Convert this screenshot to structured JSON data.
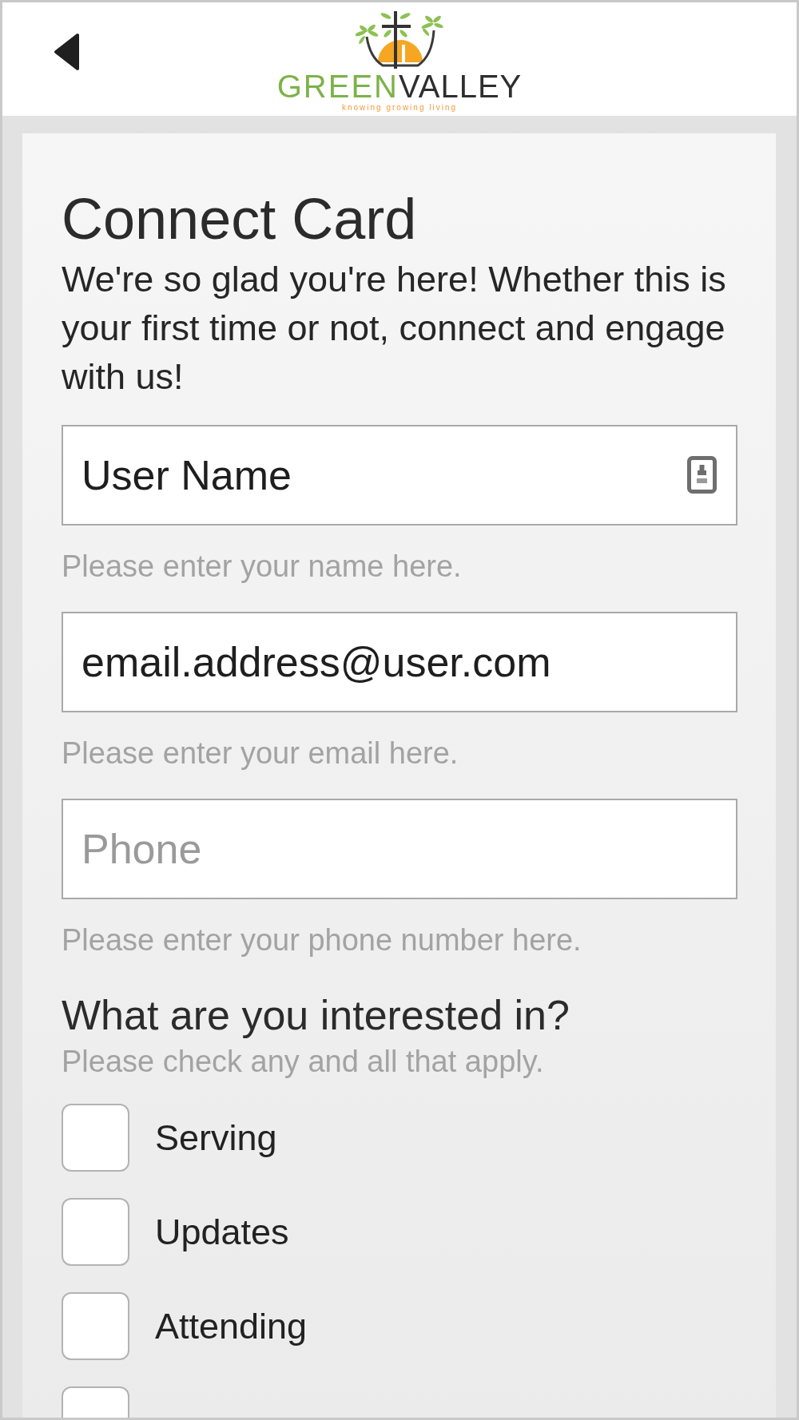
{
  "header": {
    "logo": {
      "wordmark": [
        "GREEN",
        "VALLEY"
      ],
      "tagline": "knowing growing living"
    }
  },
  "form": {
    "title": "Connect Card",
    "intro": "We're so glad you're here! Whether this is your first time or not, connect and engage with us!",
    "fields": [
      {
        "kind": "autofill",
        "value": "User Name",
        "help": "Please enter your name here."
      },
      {
        "kind": "plain",
        "value": "email.address@user.com",
        "help": "Please enter your email here."
      },
      {
        "kind": "plain",
        "placeholder": "Phone",
        "help": "Please enter your phone number here."
      }
    ],
    "interests": {
      "title": "What are you interested in?",
      "hint": "Please check any and all that apply.",
      "options": [
        {
          "label": "Serving",
          "checked": false
        },
        {
          "label": "Updates",
          "checked": false
        },
        {
          "label": "Attending",
          "checked": false
        },
        {
          "checked": false
        }
      ]
    }
  }
}
